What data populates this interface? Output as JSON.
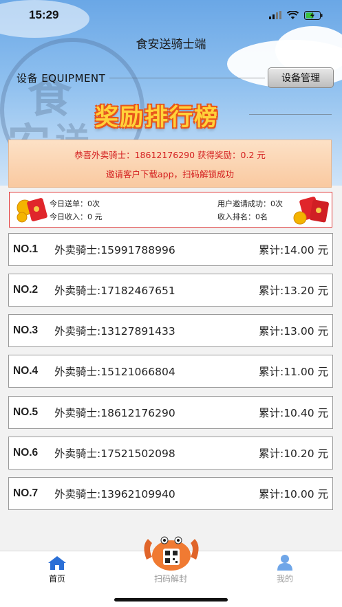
{
  "status_bar": {
    "time": "15:29"
  },
  "header": {
    "title": "食安送骑士端",
    "equipment_label": "设备 EQUIPMENT",
    "equipment_button": "设备管理",
    "ranking_title": "奖励排行榜"
  },
  "notice": {
    "line1": "恭喜外卖骑士：18612176290 获得奖励：0.2 元",
    "line2": "邀请客户下载app，扫码解锁成功"
  },
  "stats": {
    "today_orders": "今日送单：0次",
    "today_income": "今日收入：0 元",
    "invite_success": "用户邀请成功：0次",
    "income_rank": "收入排名：0名"
  },
  "ranking": [
    {
      "no": "NO.1",
      "name": "外卖骑士:15991788996",
      "total": "累计:14.00 元"
    },
    {
      "no": "NO.2",
      "name": "外卖骑士:17182467651",
      "total": "累计:13.20 元"
    },
    {
      "no": "NO.3",
      "name": "外卖骑士:13127891433",
      "total": "累计:13.00 元"
    },
    {
      "no": "NO.4",
      "name": "外卖骑士:15121066804",
      "total": "累计:11.00 元"
    },
    {
      "no": "NO.5",
      "name": "外卖骑士:18612176290",
      "total": "累计:10.40 元"
    },
    {
      "no": "NO.6",
      "name": "外卖骑士:17521502098",
      "total": "累计:10.20 元"
    },
    {
      "no": "NO.7",
      "name": "外卖骑士:13962109940",
      "total": "累计:10.00 元"
    }
  ],
  "tabs": [
    {
      "label": "首页",
      "icon": "home-icon",
      "active": true
    },
    {
      "label": "扫码解封",
      "icon": "crab-qr-icon",
      "active": false
    },
    {
      "label": "我的",
      "icon": "user-icon",
      "active": false
    }
  ],
  "colors": {
    "accent": "#2b6fd6",
    "notice_text": "#d42020",
    "stats_border": "#e03a3a"
  }
}
